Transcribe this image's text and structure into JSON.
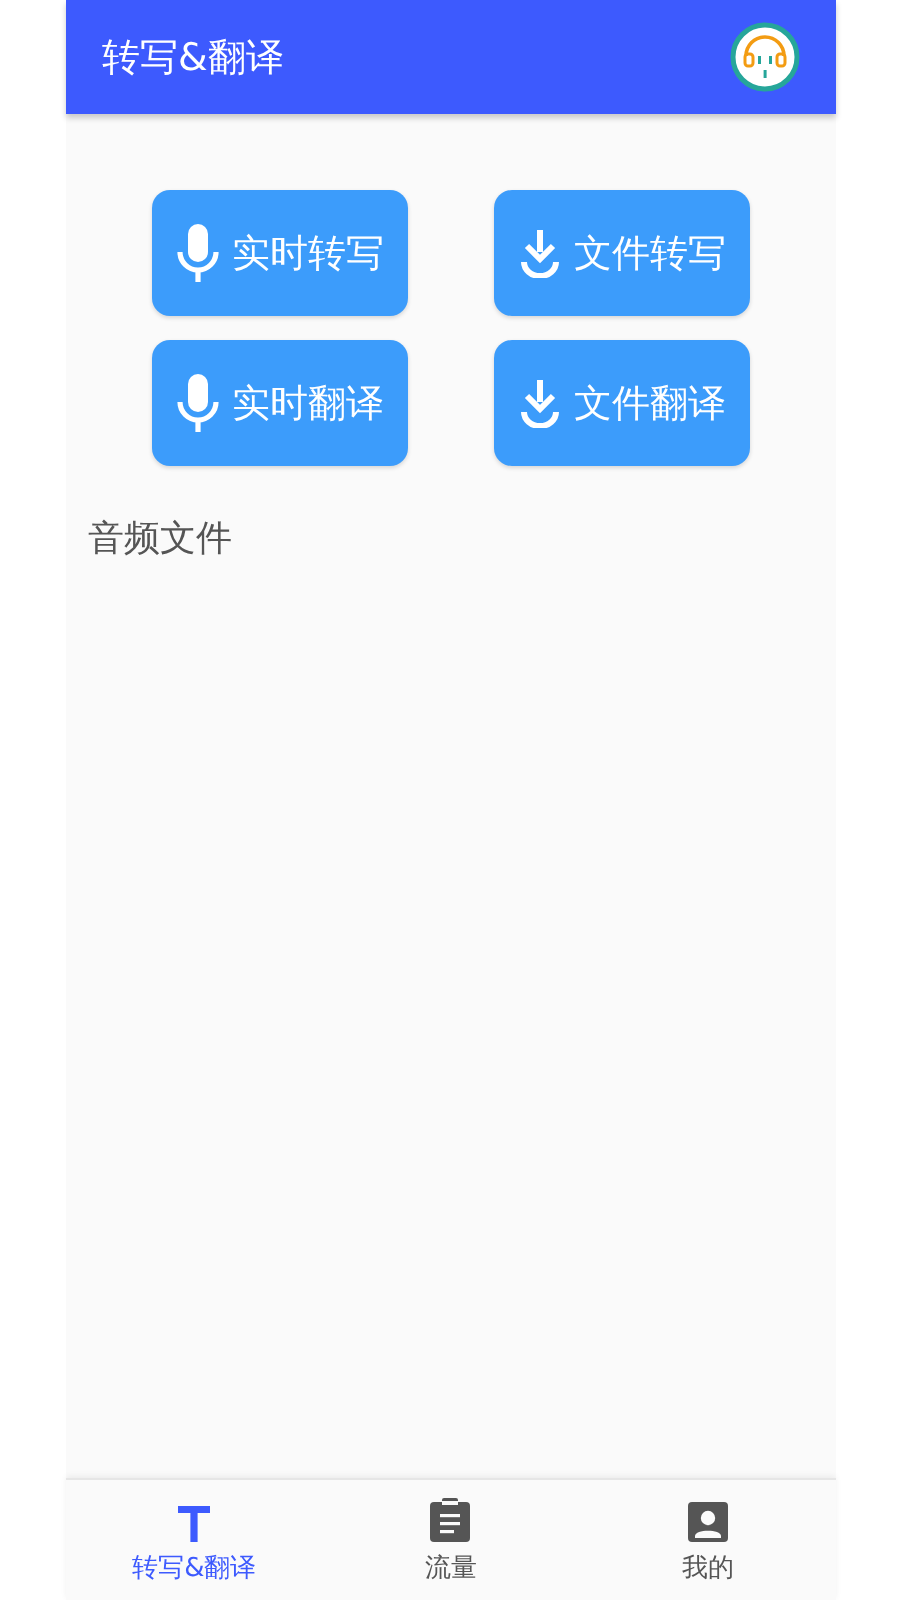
{
  "app_bar": {
    "title": "转写&翻译"
  },
  "actions": [
    {
      "label": "实时转写",
      "kind": "mic"
    },
    {
      "label": "文件转写",
      "kind": "download"
    },
    {
      "label": "实时翻译",
      "kind": "mic"
    },
    {
      "label": "文件翻译",
      "kind": "download"
    }
  ],
  "section": {
    "title": "音频文件"
  },
  "bottom_nav": [
    {
      "label": "转写&翻译",
      "kind": "text",
      "selected": true
    },
    {
      "label": "流量",
      "kind": "clipboard",
      "selected": false
    },
    {
      "label": "我的",
      "kind": "account",
      "selected": false
    }
  ]
}
